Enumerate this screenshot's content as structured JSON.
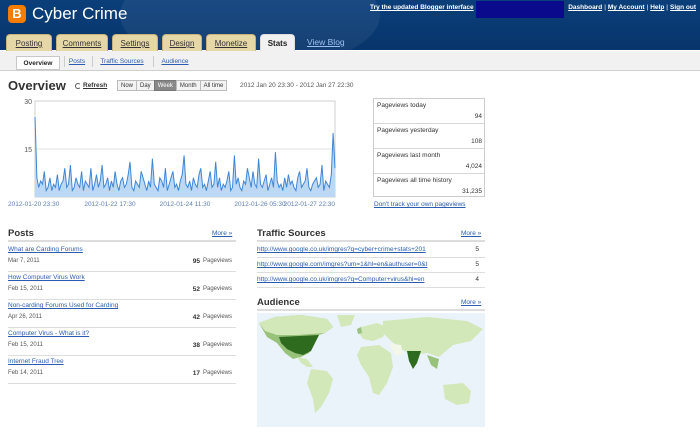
{
  "header": {
    "blog_title": "Cyber Crime",
    "try_link": "Try the updated Blogger interface",
    "links": [
      "Dashboard",
      "My Account",
      "Help",
      "Sign out"
    ],
    "logo_icon": "blogger-logo-icon",
    "brand_color": "#0b3f7a"
  },
  "tabs": [
    "Posting",
    "Comments",
    "Settings",
    "Design",
    "Monetize",
    "Stats"
  ],
  "active_tab": "Stats",
  "view_blog": "View Blog",
  "subtabs": [
    "Overview",
    "Posts",
    "Traffic Sources",
    "Audience"
  ],
  "active_subtab": "Overview",
  "overview": {
    "title": "Overview",
    "refresh": "Refresh",
    "range_buttons": [
      "Now",
      "Day",
      "Week",
      "Month",
      "All time"
    ],
    "selected_range": "Week",
    "date_range": "2012 Jan 20 23:30 - 2012 Jan 27 22:30"
  },
  "chart_data": {
    "type": "area",
    "y_ticks": [
      "30",
      "15"
    ],
    "ylim": [
      0,
      30
    ],
    "x_ticks": [
      "2012-01-20 23:30",
      "2012-01-22 17:30",
      "2012-01-24 11:30",
      "2012-01-26 05:30",
      "2012-01-27 22:30"
    ],
    "values": [
      25,
      6,
      3,
      5,
      4,
      8,
      2,
      3,
      6,
      2,
      4,
      3,
      7,
      2,
      4,
      5,
      9,
      3,
      4,
      10,
      2,
      3,
      6,
      4,
      3,
      8,
      2,
      5,
      4,
      3,
      9,
      2,
      4,
      7,
      3,
      5,
      10,
      3,
      4,
      6,
      2,
      5,
      3,
      8,
      4,
      2,
      5,
      6,
      3,
      4,
      7,
      11,
      3,
      2,
      5,
      4,
      3,
      8,
      6,
      4,
      2,
      5,
      3,
      12,
      4,
      3,
      2,
      6,
      5,
      3,
      9,
      2,
      4,
      6,
      8,
      3,
      4,
      2,
      5,
      7,
      13,
      4,
      3,
      5,
      2,
      6,
      4,
      3,
      7,
      9,
      3,
      4,
      2,
      5,
      8,
      3,
      4,
      11,
      3,
      6,
      2,
      4,
      3,
      5,
      8,
      2,
      3,
      13,
      4,
      6,
      3,
      2,
      5,
      4,
      9,
      6,
      3,
      8,
      4,
      3,
      12,
      4,
      3,
      5,
      7,
      2,
      4,
      6,
      3,
      14,
      5,
      3,
      4,
      2,
      6,
      3,
      7,
      4,
      5,
      3,
      2,
      6,
      8,
      3,
      4,
      5,
      9,
      3,
      2,
      4,
      5,
      6,
      3,
      4,
      10,
      2,
      5,
      4,
      3,
      7,
      20,
      9
    ],
    "line_color": "#3f87d6",
    "fill_color": "#bcd8f4"
  },
  "stats": [
    {
      "label": "Pageviews today",
      "value": "94"
    },
    {
      "label": "Pageviews yesterday",
      "value": "108"
    },
    {
      "label": "Pageviews last month",
      "value": "4,024"
    },
    {
      "label": "Pageviews all time history",
      "value": "31,235"
    }
  ],
  "dont_track": "Don't track your own pageviews",
  "posts": {
    "title": "Posts",
    "more": "More »",
    "unit": "Pageviews",
    "items": [
      {
        "title": "What are Carding Forums",
        "date": "Mar 7, 2011",
        "count": "95"
      },
      {
        "title": "How Computer Virus Work",
        "date": "Feb 15, 2011",
        "count": "52"
      },
      {
        "title": "Non-carding Forums Used for Carding",
        "date": "Apr 26, 2011",
        "count": "42"
      },
      {
        "title": "Computer Virus - What is it?",
        "date": "Feb 15, 2011",
        "count": "38"
      },
      {
        "title": "Internet Fraud Tree",
        "date": "Feb 14, 2011",
        "count": "17"
      }
    ]
  },
  "traffic": {
    "title": "Traffic Sources",
    "more": "More »",
    "items": [
      {
        "url": "http://www.google.co.uk/imgres?q=cyber+crime+stats+201",
        "count": "5"
      },
      {
        "url": "http://www.google.com/imgres?um=1&hl=en&authuser=0&t",
        "count": "5"
      },
      {
        "url": "http://www.google.co.uk/imgres?q=Computer+virus&hl=en",
        "count": "4"
      }
    ]
  },
  "audience": {
    "title": "Audience",
    "more": "More »",
    "map_colors": {
      "ocean": "#eaf2fa",
      "land": "#f2f7ea",
      "light": "#d3e8b9",
      "mid": "#98c27a",
      "dark": "#2f6b1f"
    }
  }
}
